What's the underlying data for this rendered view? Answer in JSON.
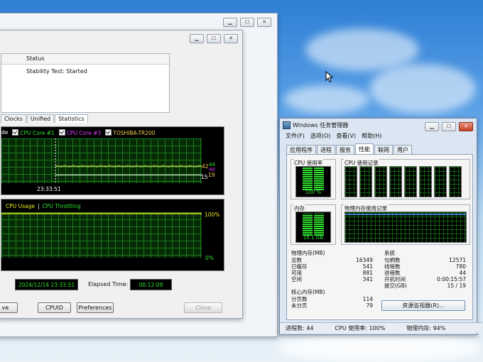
{
  "stability": {
    "status_header": "Status",
    "status_value": "Stability Test: Started",
    "tabs": [
      "Clocks",
      "Unified",
      "Statistics"
    ],
    "graph1": {
      "legend": [
        {
          "label": "de",
          "color": "#ffffff"
        },
        {
          "label": "CPU Core #1",
          "color": "#2fe22f"
        },
        {
          "label": "CPU Core #3",
          "color": "#e23cff"
        },
        {
          "label": "TOSHIBA-TR200",
          "color": "#f3c94a"
        }
      ],
      "time_label": "23:33:51",
      "value_top_a": "42",
      "value_top_b": "44",
      "value_top_c": "40",
      "value_mid": "15",
      "value_low": "19",
      "series_top": [
        0.4,
        0.4,
        0.4,
        0.4,
        0.4,
        0.4,
        0.4,
        0.4,
        0.4,
        0.4,
        0.4,
        0.4,
        0.4,
        0.4,
        0.4,
        0.4,
        0.4,
        0.4,
        0.4,
        0.4,
        0.4,
        0.4,
        0.4,
        0.4,
        0.4,
        0.4,
        0.4,
        0.4,
        0.4,
        0.4,
        0.4,
        0.4,
        0.4,
        0.4,
        0.4,
        0.4,
        0.4,
        0.4,
        0.4,
        0.4,
        0.4,
        0.4,
        0.4,
        0.4,
        0.4,
        0.4,
        0.4,
        0.4,
        0.4,
        0.4
      ],
      "series_bottom": [
        0.19,
        0.19,
        0.19,
        0.19,
        0.19,
        0.19,
        0.19,
        0.19,
        0.19,
        0.19,
        0.19,
        0.19,
        0.19,
        0.19,
        0.19,
        0.19,
        0.19,
        0.19,
        0.19,
        0.19,
        0.19,
        0.19,
        0.19,
        0.19,
        0.19,
        0.19,
        0.19,
        0.19,
        0.19,
        0.19,
        0.19,
        0.19,
        0.19,
        0.19,
        0.19,
        0.19,
        0.19,
        0.19,
        0.19,
        0.19,
        0.19,
        0.19,
        0.19,
        0.19,
        0.19,
        0.19,
        0.19,
        0.19,
        0.19,
        0.19
      ]
    },
    "graph2": {
      "label_usage": "CPU Usage",
      "separator": "|",
      "label_throttle": "CPU Throttling",
      "top_pct": "100%",
      "bottom_pct": "0%"
    },
    "started_at": "2024/12/14 23:33:51",
    "elapsed_label": "Elapsed Time:",
    "elapsed_value": "00:12:09",
    "buttons": {
      "save": "ve",
      "cpuid": "CPUID",
      "preferences": "Preferences",
      "close": "Close"
    }
  },
  "taskmgr": {
    "title": "Windows 任务管理器",
    "menu": [
      "文件(F)",
      "选项(O)",
      "查看(V)",
      "帮助(H)"
    ],
    "tabs": [
      "应用程序",
      "进程",
      "服务",
      "性能",
      "联网",
      "用户"
    ],
    "active_tab": "性能",
    "cpu_usage_caption": "CPU 使用率",
    "cpu_usage_value": "100 %",
    "cpu_history_caption": "CPU 使用记录",
    "mem_caption": "内存",
    "mem_value": "15.1 GB",
    "mem_history_caption": "物理内存使用记录",
    "physical_mem": {
      "caption": "物理内存(MB)",
      "rows": [
        {
          "label": "总数",
          "value": "16349"
        },
        {
          "label": "已缓存",
          "value": "541"
        },
        {
          "label": "可用",
          "value": "881"
        },
        {
          "label": "空闲",
          "value": "341"
        }
      ]
    },
    "system": {
      "caption": "系统",
      "rows": [
        {
          "label": "句柄数",
          "value": "12571"
        },
        {
          "label": "线程数",
          "value": "780"
        },
        {
          "label": "进程数",
          "value": "44"
        },
        {
          "label": "开机时间",
          "value": "0:00:15:57"
        },
        {
          "label": "提交(GB)",
          "value": "15 / 19"
        }
      ]
    },
    "kernel_mem": {
      "caption": "核心内存(MB)",
      "rows": [
        {
          "label": "分页数",
          "value": "114"
        },
        {
          "label": "未分页",
          "value": "79"
        }
      ]
    },
    "resource_monitor_button": "资源监视器(R)...",
    "status": {
      "processes": "进程数: 44",
      "cpu": "CPU 使用率: 100%",
      "memory": "物理内存: 94%"
    }
  }
}
